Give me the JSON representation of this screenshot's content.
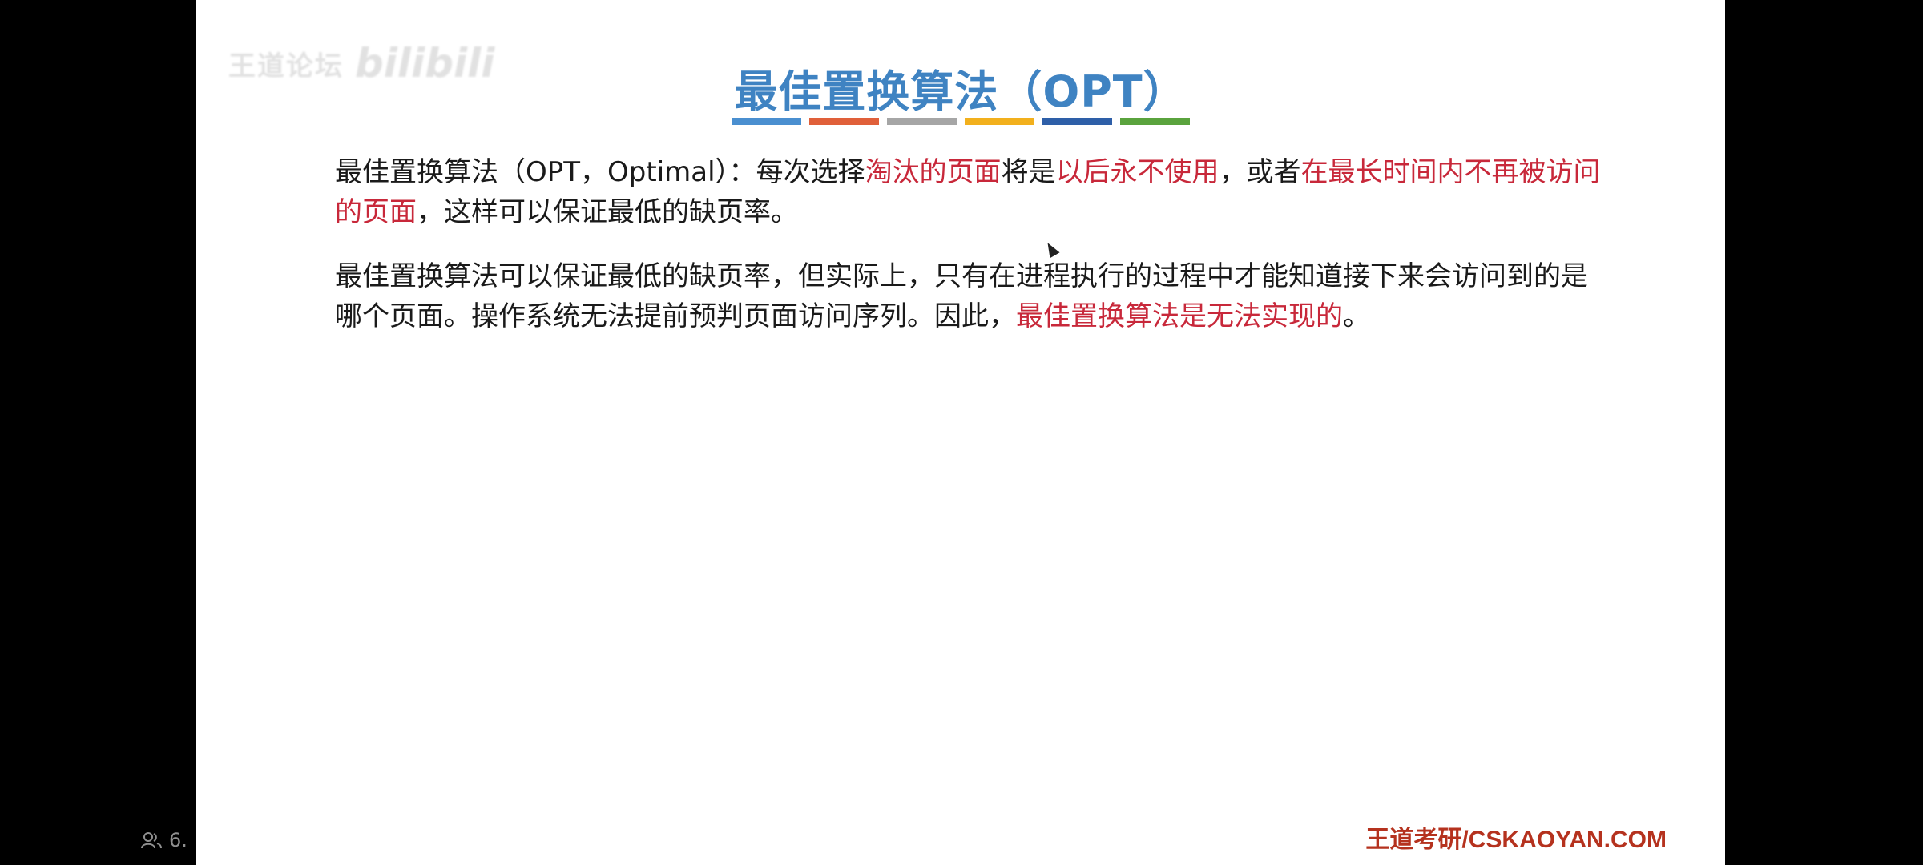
{
  "watermark": {
    "text": "王道论坛",
    "logo": "bilibili"
  },
  "slide": {
    "title": "最佳置换算法（OPT）",
    "title_bar_colors": [
      "#4a8fd0",
      "#e0603a",
      "#a6a6a6",
      "#f2b01d",
      "#2e5fa8",
      "#5aa33d"
    ],
    "paragraph1": [
      {
        "text": "最佳置换算法（OPT，Optimal）：每次选择",
        "highlight": false
      },
      {
        "text": "淘汰的页面",
        "highlight": true
      },
      {
        "text": "将是",
        "highlight": false
      },
      {
        "text": "以后永不使用",
        "highlight": true
      },
      {
        "text": "，或者",
        "highlight": false
      },
      {
        "text": "在最长时间内不再被访问的页面",
        "highlight": true
      },
      {
        "text": "，这样可以保证最低的缺页率。",
        "highlight": false
      }
    ],
    "paragraph2": [
      {
        "text": "最佳置换算法可以保证最低的缺页率，但实际上，只有在进程执行的过程中才能知道接下来会访问到的是哪个页面。操作系统无法提前预判页面访问序列。因此，",
        "highlight": false
      },
      {
        "text": "最佳置换算法是无法实现的",
        "highlight": true
      },
      {
        "text": "。",
        "highlight": false
      }
    ],
    "footer": "王道考研/CSKAOYAN.COM"
  },
  "overlay": {
    "icon": "people-icon",
    "text": "6."
  },
  "colors": {
    "title": "#3f83c2",
    "highlight": "#c8283a",
    "footer": "#b5321e"
  }
}
